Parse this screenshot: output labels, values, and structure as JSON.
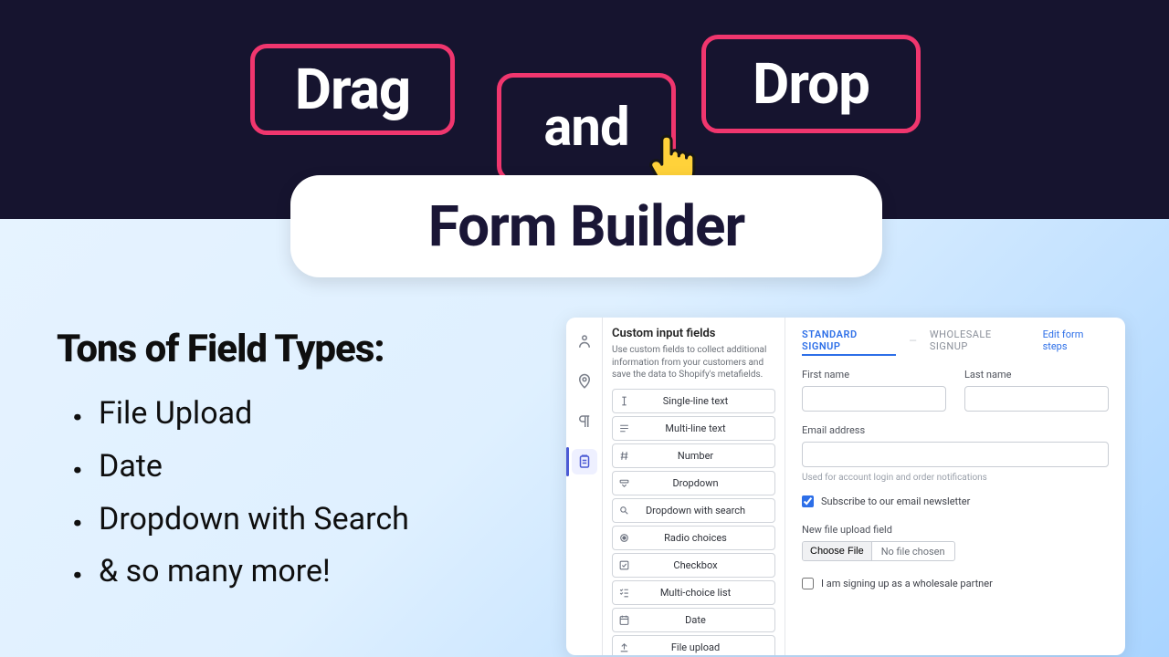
{
  "hero": {
    "drag": "Drag",
    "and": "and",
    "drop": "Drop",
    "form_builder": "Form Builder"
  },
  "field_types": {
    "heading": "Tons of Field Types:",
    "items": [
      "File Upload",
      "Date",
      "Dropdown with Search",
      "& so many more!"
    ]
  },
  "app": {
    "custom_fields": {
      "title": "Custom input fields",
      "desc": "Use custom fields to collect additional information from your customers and save the data to Shopify's metafields."
    },
    "field_type_list": [
      "Single-line text",
      "Multi-line text",
      "Number",
      "Dropdown",
      "Dropdown with search",
      "Radio choices",
      "Checkbox",
      "Multi-choice list",
      "Date",
      "File upload"
    ],
    "tabs": {
      "standard": "STANDARD SIGNUP",
      "wholesale": "WHOLESALE SIGNUP",
      "edit": "Edit form steps"
    },
    "form": {
      "first_name_label": "First name",
      "last_name_label": "Last name",
      "email_label": "Email address",
      "email_helper": "Used for account login and order notifications",
      "subscribe_label": "Subscribe to our email newsletter",
      "upload_label": "New file upload field",
      "choose_file": "Choose File",
      "no_file": "No file chosen",
      "wholesale_cb": "I am signing up as a wholesale partner"
    }
  }
}
